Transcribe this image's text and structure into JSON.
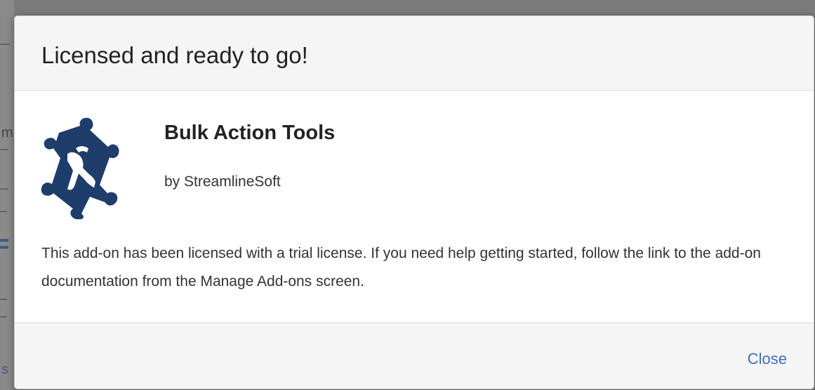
{
  "dialog": {
    "title": "Licensed and ready to go!",
    "addon": {
      "name": "Bulk Action Tools",
      "vendor": "by StreamlineSoft",
      "logo_icon": "puzzle-piece-icon",
      "logo_color": "#1f3d6b"
    },
    "description": "This add-on has been licensed with a trial license. If you need help getting started, follow the link to the add-on documentation from the Manage Add-ons screen.",
    "footer": {
      "close_label": "Close",
      "link_color": "#3f6fb5"
    }
  }
}
